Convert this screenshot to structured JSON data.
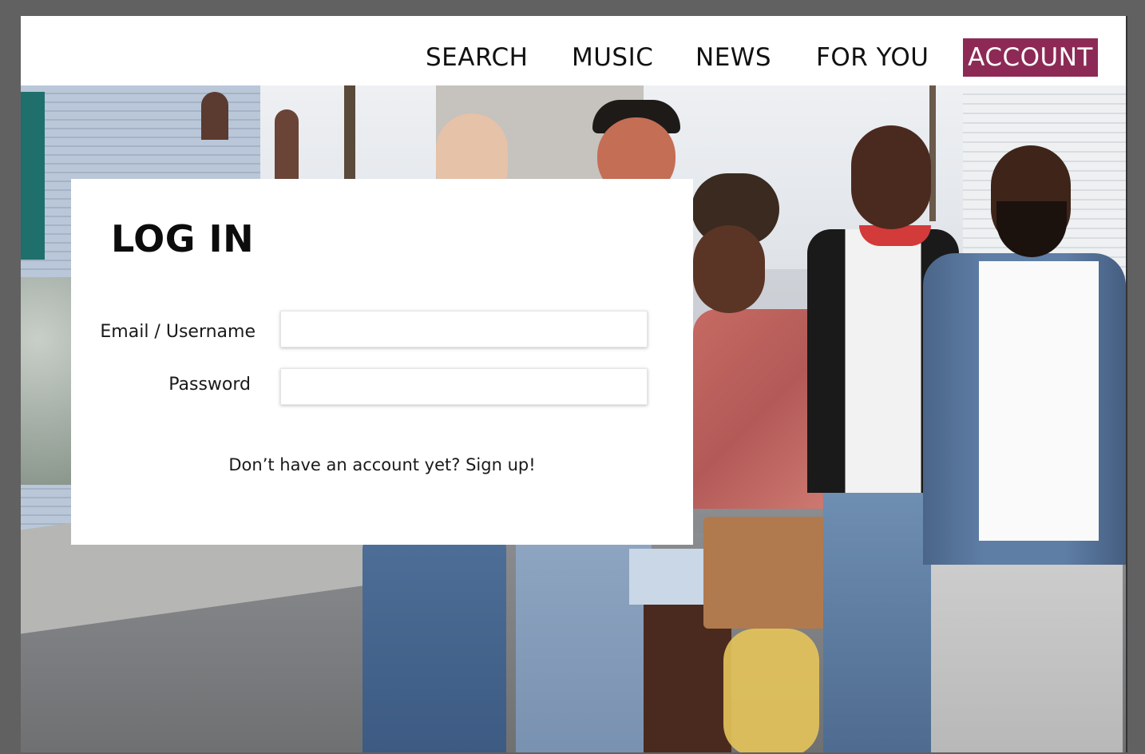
{
  "nav": {
    "items": [
      {
        "label": "SEARCH"
      },
      {
        "label": "MUSIC"
      },
      {
        "label": "NEWS"
      },
      {
        "label": "FOR YOU"
      },
      {
        "label": "ACCOUNT",
        "active": true
      }
    ],
    "active_color": "#8c2a55"
  },
  "login": {
    "title": "LOG IN",
    "email_label": "Email / Username",
    "email_value": "",
    "password_label": "Password",
    "password_value": "",
    "signup_prompt": "Don’t have an account yet?",
    "signup_link": "Sign up!"
  }
}
